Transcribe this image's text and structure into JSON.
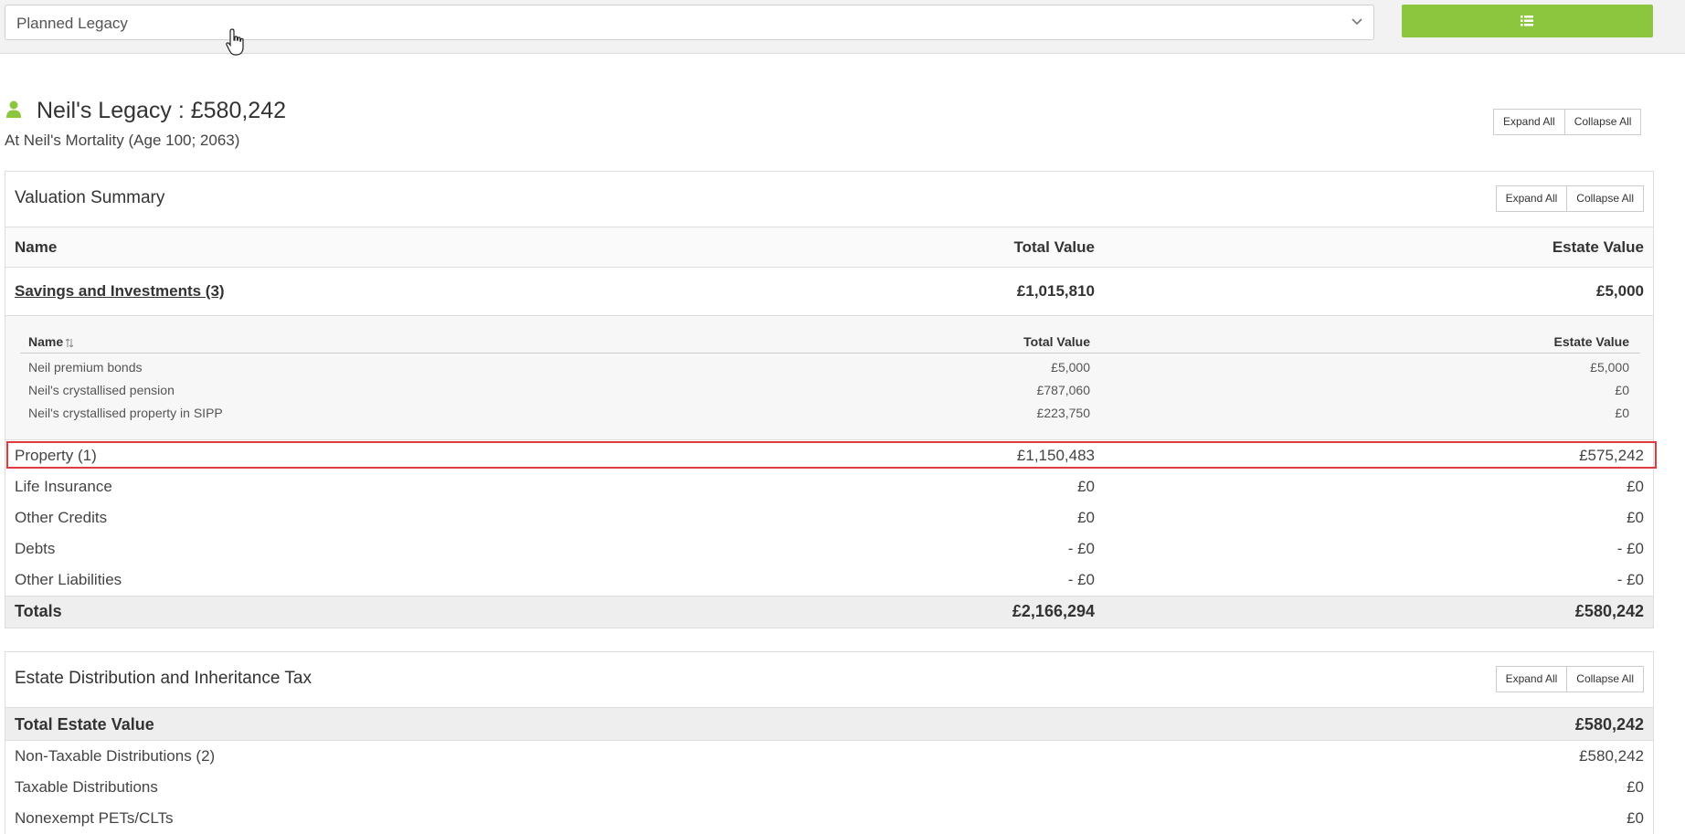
{
  "selector": {
    "value": "Planned Legacy"
  },
  "legacy": {
    "title": "Neil's Legacy : £580,242",
    "subtitle": "At Neil's Mortality (Age 100; 2063)",
    "expand_all": "Expand All",
    "collapse_all": "Collapse All"
  },
  "valuation": {
    "title": "Valuation Summary",
    "expand_all": "Expand All",
    "collapse_all": "Collapse All",
    "columns": {
      "name": "Name",
      "total": "Total Value",
      "estate": "Estate Value"
    },
    "savings": {
      "name": "Savings and Investments (3)",
      "total": "£1,015,810",
      "estate": "£5,000"
    },
    "sub_columns": {
      "name": "Name",
      "total": "Total Value",
      "estate": "Estate Value"
    },
    "sub_rows": [
      {
        "name": "Neil premium bonds",
        "total": "£5,000",
        "estate": "£5,000"
      },
      {
        "name": "Neil's crystallised pension",
        "total": "£787,060",
        "estate": "£0"
      },
      {
        "name": "Neil's crystallised property in SIPP",
        "total": "£223,750",
        "estate": "£0"
      }
    ],
    "rows": [
      {
        "name": "Property (1)",
        "total": "£1,150,483",
        "estate": "£575,242"
      },
      {
        "name": "Life Insurance",
        "total": "£0",
        "estate": "£0"
      },
      {
        "name": "Other Credits",
        "total": "£0",
        "estate": "£0"
      },
      {
        "name": "Debts",
        "total": "- £0",
        "estate": "- £0"
      },
      {
        "name": "Other Liabilities",
        "total": "- £0",
        "estate": "- £0"
      }
    ],
    "totals": {
      "name": "Totals",
      "total": "£2,166,294",
      "estate": "£580,242"
    }
  },
  "estate": {
    "title": "Estate Distribution and Inheritance Tax",
    "expand_all": "Expand All",
    "collapse_all": "Collapse All",
    "total_row": {
      "name": "Total Estate Value",
      "value": "£580,242"
    },
    "rows": [
      {
        "name": "Non-Taxable Distributions (2)",
        "value": "£580,242"
      },
      {
        "name": "Taxable Distributions",
        "value": "£0"
      },
      {
        "name": "Nonexempt PETs/CLTs",
        "value": "£0"
      }
    ]
  },
  "colors": {
    "accent": "#8cc63f",
    "highlight": "#e0393e"
  }
}
